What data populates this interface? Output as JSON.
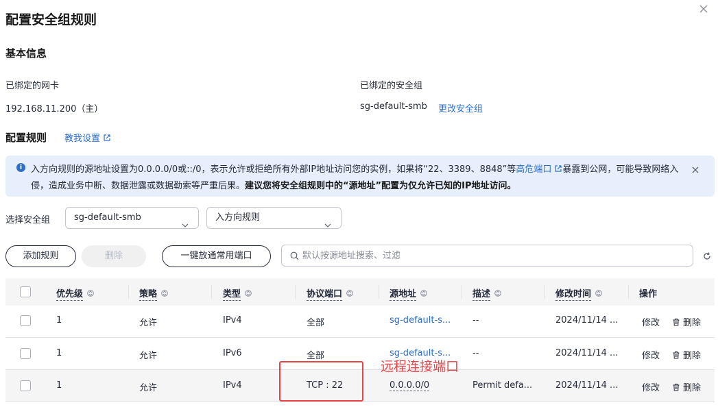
{
  "dialog": {
    "title": "配置安全组规则"
  },
  "basic_info": {
    "section_title": "基本信息",
    "nic_label": "已绑定的网卡",
    "nic_value": "192.168.11.200（主）",
    "sg_label": "已绑定的安全组",
    "sg_value": "sg-default-smb",
    "change_sg_link": "更改安全组"
  },
  "rules_section": {
    "title": "配置规则",
    "teach_link": "教我设置"
  },
  "alert": {
    "text_before": "入方向规则的源地址设置为0.0.0.0/0或::/0，表示允许或拒绝所有外部IP地址访问您的实例，如果将“22、3389、8848”等",
    "link": "高危端口",
    "text_after": "暴露到公网，可能导致网络入侵，造成业务中断、数据泄露或数据勒索等严重后果。",
    "bold": "建议您将安全组规则中的“源地址”配置为仅允许已知的IP地址访问。"
  },
  "filters": {
    "select_label": "选择安全组",
    "sg_select": "sg-default-smb",
    "direction_select": "入方向规则"
  },
  "toolbar": {
    "add_label": "添加规则",
    "delete_label": "删除",
    "open_ports_label": "一键放通常用端口",
    "search_placeholder": "默认按源地址搜索、过滤"
  },
  "table": {
    "headers": [
      "优先级",
      "策略",
      "类型",
      "协议端口",
      "源地址",
      "描述",
      "修改时间",
      "操作"
    ],
    "rows": [
      {
        "priority": "1",
        "policy": "允许",
        "type": "IPv4",
        "port": "全部",
        "source": "sg-default-s...",
        "desc": "--",
        "time": "2024/11/14 ...",
        "edit": "修改",
        "delete": "删除"
      },
      {
        "priority": "1",
        "policy": "允许",
        "type": "IPv6",
        "port": "全部",
        "source": "sg-default-s...",
        "desc": "--",
        "time": "2024/11/14 ...",
        "edit": "修改",
        "delete": "删除"
      },
      {
        "priority": "1",
        "policy": "允许",
        "type": "IPv4",
        "port": "TCP : 22",
        "source": "0.0.0.0/0",
        "desc": "Permit defa...",
        "time": "2024/11/14 ...",
        "edit": "修改",
        "delete": "删除"
      }
    ]
  },
  "annotation": {
    "text": "远程连接端口"
  },
  "colors": {
    "brand_link": "#2e6fcc",
    "alert_bg": "#e6effb",
    "annotation_red": "#e64548"
  }
}
